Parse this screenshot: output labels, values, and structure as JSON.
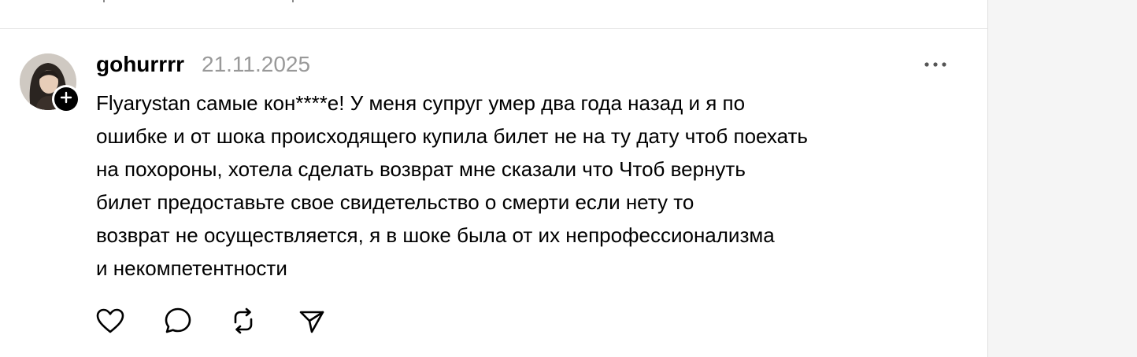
{
  "post": {
    "author": "gohurrrr",
    "date": "21.11.2025",
    "lines": [
      "Flyarystan самые кон****е! У меня супруг умер два года назад и я по",
      "ошибке и от шока происходящего купила билет не на ту дату чтоб поехать",
      "на похороны, хотела сделать возврат мне сказали что Чтоб вернуть",
      "билет предоставьте свое свидетельство о смерти если нету то",
      "возврат не осуществляется, я в шоке была от их непрофессионализма",
      "и некомпетентности"
    ]
  },
  "icons": {
    "follow": "plus-icon",
    "more": "more-horizontal-icon",
    "like": "heart-icon",
    "comment": "comment-bubble-icon",
    "repost": "repost-icon",
    "share": "send-icon"
  },
  "colors": {
    "text": "#000000",
    "muted": "#999999",
    "divider": "#e3e3e3",
    "side_panel": "#f5f5f5"
  }
}
